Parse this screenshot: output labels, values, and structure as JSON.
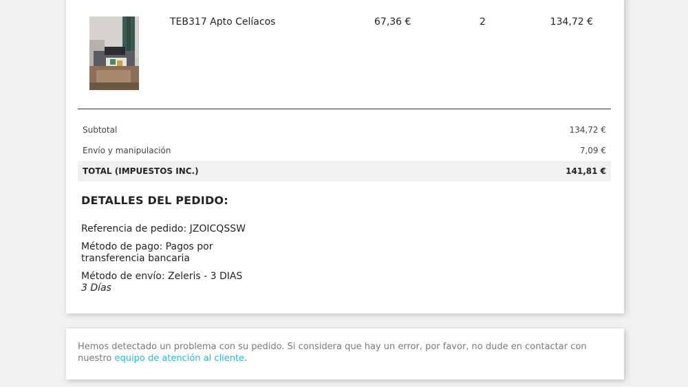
{
  "order_item": {
    "name": "TEB317 Apto Celíacos",
    "unit_price": "67,36 €",
    "quantity": "2",
    "line_total": "134,72 €"
  },
  "totals": {
    "subtotal_label": "Subtotal",
    "subtotal_value": "134,72 €",
    "shipping_label": "Envío y manipulación",
    "shipping_value": "7,09 €",
    "total_label": "TOTAL (IMPUESTOS INC.)",
    "total_value": "141,81 €"
  },
  "details": {
    "title": "DETALLES DEL PEDIDO:",
    "reference": "Referencia de pedido: JZOICQSSW",
    "payment": "Método de pago: Pagos por transferencia bancaria",
    "shipping": "Método de envío: Zeleris - 3 DIAS",
    "shipping_note": "3 Días"
  },
  "message": {
    "text": "Hemos detectado un problema con su pedido. Si considera que hay un error, por favor, no dude en contactar con nuestro ",
    "link_text": "equipo de atención al cliente",
    "trailing": "."
  },
  "colors": {
    "page_background": "#f1f1f1",
    "card_background": "#ffffff",
    "link": "#24b9d7",
    "total_row_background": "#f1f1f1"
  }
}
